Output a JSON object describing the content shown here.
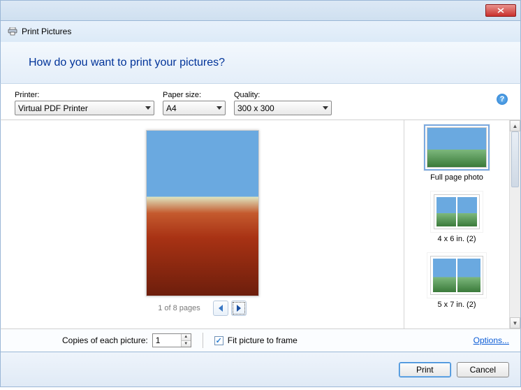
{
  "window": {
    "title": "Print Pictures"
  },
  "header": {
    "question": "How do you want to print your pictures?"
  },
  "config": {
    "printer_label": "Printer:",
    "printer_value": "Virtual PDF Printer",
    "paper_label": "Paper size:",
    "paper_value": "A4",
    "quality_label": "Quality:",
    "quality_value": "300 x 300"
  },
  "preview": {
    "counter": "1 of 8 pages"
  },
  "layouts": {
    "full": "Full page photo",
    "l4x6": "4 x 6 in. (2)",
    "l5x7": "5 x 7 in. (2)"
  },
  "copies": {
    "label": "Copies of each picture:",
    "value": "1",
    "fit_label": "Fit picture to frame",
    "fit_checked": true,
    "options": "Options..."
  },
  "actions": {
    "print": "Print",
    "cancel": "Cancel"
  }
}
